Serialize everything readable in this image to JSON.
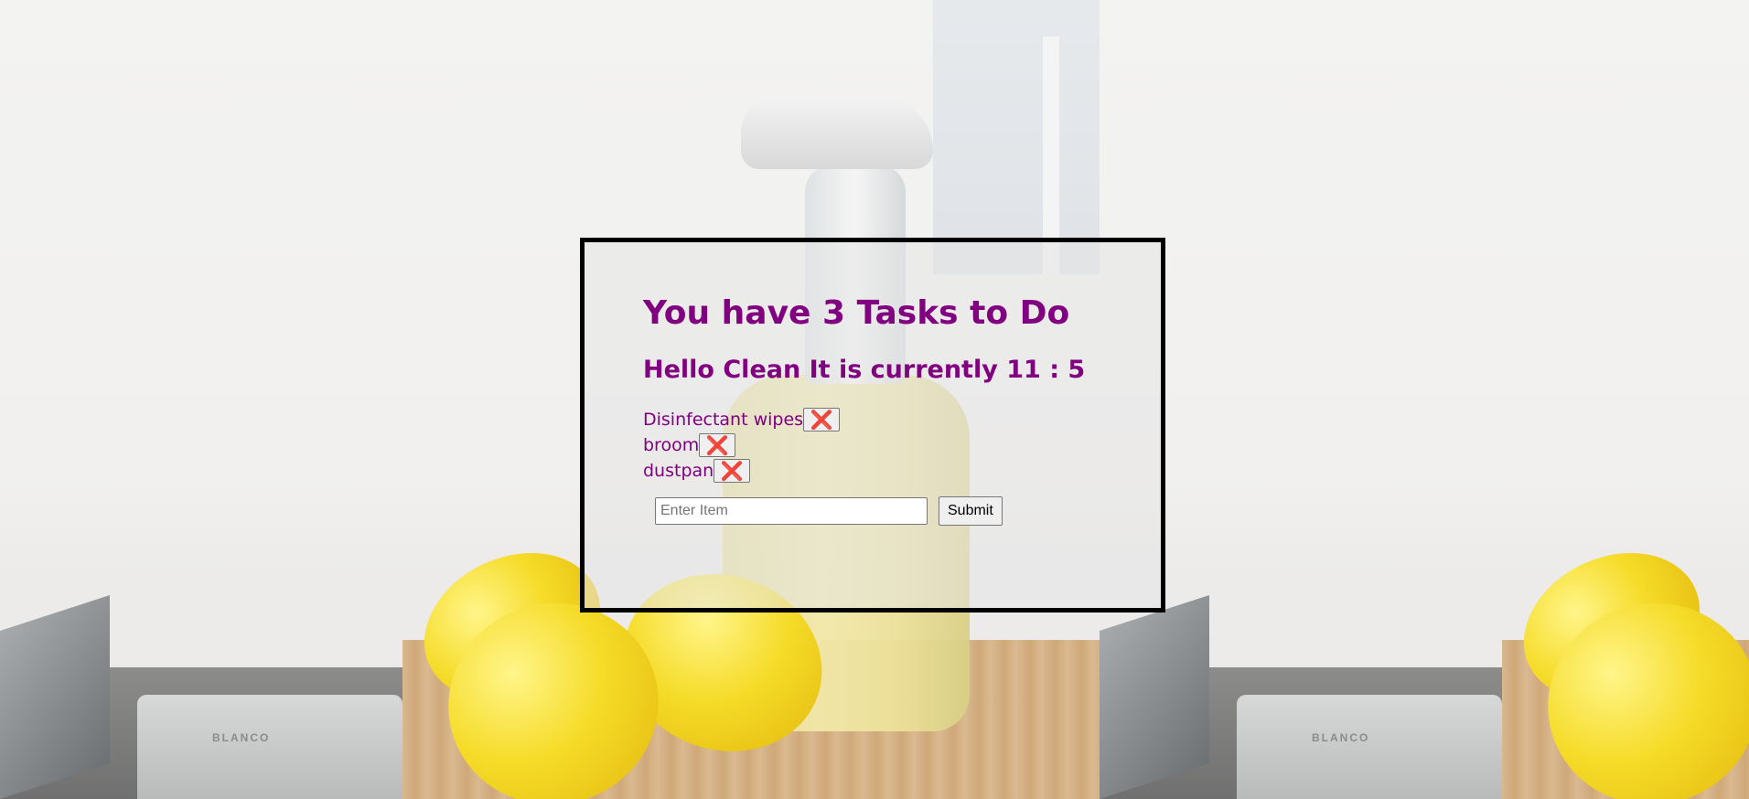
{
  "heading": {
    "tasks_title": "You have 3 Tasks to Do",
    "greeting": "Hello Clean It is currently 11 : 5"
  },
  "tasks": [
    {
      "label": "Disinfectant wipes",
      "delete_icon": "❌"
    },
    {
      "label": "broom",
      "delete_icon": "❌"
    },
    {
      "label": "dustpan",
      "delete_icon": "❌"
    }
  ],
  "form": {
    "placeholder": "Enter Item",
    "submit_label": "Submit"
  },
  "background": {
    "sink_brand": "BLANCO"
  },
  "colors": {
    "accent": "#800080",
    "delete_icon": "#e0201d",
    "panel_border": "#000000"
  }
}
